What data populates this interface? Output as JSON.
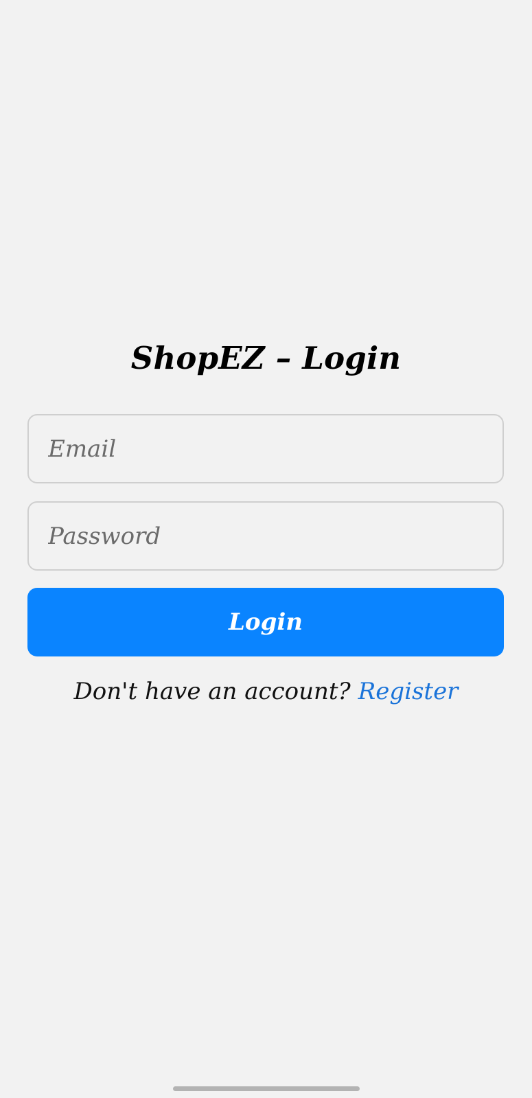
{
  "header": {
    "title": "ShopEZ – Login"
  },
  "form": {
    "email": {
      "value": "",
      "placeholder": "Email"
    },
    "password": {
      "value": "",
      "placeholder": "Password"
    },
    "submit_label": "Login"
  },
  "footer": {
    "prompt": "Don't have an account?",
    "register_label": "Register"
  },
  "colors": {
    "background": "#f2f2f2",
    "primary": "#0a84ff",
    "link": "#1a73d9"
  }
}
